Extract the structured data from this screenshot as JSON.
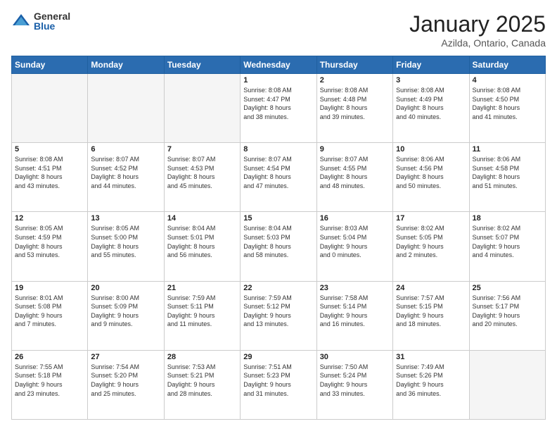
{
  "header": {
    "logo": {
      "general": "General",
      "blue": "Blue"
    },
    "title": "January 2025",
    "location": "Azilda, Ontario, Canada"
  },
  "days_of_week": [
    "Sunday",
    "Monday",
    "Tuesday",
    "Wednesday",
    "Thursday",
    "Friday",
    "Saturday"
  ],
  "weeks": [
    [
      {
        "day": "",
        "info": ""
      },
      {
        "day": "",
        "info": ""
      },
      {
        "day": "",
        "info": ""
      },
      {
        "day": "1",
        "info": "Sunrise: 8:08 AM\nSunset: 4:47 PM\nDaylight: 8 hours\nand 38 minutes."
      },
      {
        "day": "2",
        "info": "Sunrise: 8:08 AM\nSunset: 4:48 PM\nDaylight: 8 hours\nand 39 minutes."
      },
      {
        "day": "3",
        "info": "Sunrise: 8:08 AM\nSunset: 4:49 PM\nDaylight: 8 hours\nand 40 minutes."
      },
      {
        "day": "4",
        "info": "Sunrise: 8:08 AM\nSunset: 4:50 PM\nDaylight: 8 hours\nand 41 minutes."
      }
    ],
    [
      {
        "day": "5",
        "info": "Sunrise: 8:08 AM\nSunset: 4:51 PM\nDaylight: 8 hours\nand 43 minutes."
      },
      {
        "day": "6",
        "info": "Sunrise: 8:07 AM\nSunset: 4:52 PM\nDaylight: 8 hours\nand 44 minutes."
      },
      {
        "day": "7",
        "info": "Sunrise: 8:07 AM\nSunset: 4:53 PM\nDaylight: 8 hours\nand 45 minutes."
      },
      {
        "day": "8",
        "info": "Sunrise: 8:07 AM\nSunset: 4:54 PM\nDaylight: 8 hours\nand 47 minutes."
      },
      {
        "day": "9",
        "info": "Sunrise: 8:07 AM\nSunset: 4:55 PM\nDaylight: 8 hours\nand 48 minutes."
      },
      {
        "day": "10",
        "info": "Sunrise: 8:06 AM\nSunset: 4:56 PM\nDaylight: 8 hours\nand 50 minutes."
      },
      {
        "day": "11",
        "info": "Sunrise: 8:06 AM\nSunset: 4:58 PM\nDaylight: 8 hours\nand 51 minutes."
      }
    ],
    [
      {
        "day": "12",
        "info": "Sunrise: 8:05 AM\nSunset: 4:59 PM\nDaylight: 8 hours\nand 53 minutes."
      },
      {
        "day": "13",
        "info": "Sunrise: 8:05 AM\nSunset: 5:00 PM\nDaylight: 8 hours\nand 55 minutes."
      },
      {
        "day": "14",
        "info": "Sunrise: 8:04 AM\nSunset: 5:01 PM\nDaylight: 8 hours\nand 56 minutes."
      },
      {
        "day": "15",
        "info": "Sunrise: 8:04 AM\nSunset: 5:03 PM\nDaylight: 8 hours\nand 58 minutes."
      },
      {
        "day": "16",
        "info": "Sunrise: 8:03 AM\nSunset: 5:04 PM\nDaylight: 9 hours\nand 0 minutes."
      },
      {
        "day": "17",
        "info": "Sunrise: 8:02 AM\nSunset: 5:05 PM\nDaylight: 9 hours\nand 2 minutes."
      },
      {
        "day": "18",
        "info": "Sunrise: 8:02 AM\nSunset: 5:07 PM\nDaylight: 9 hours\nand 4 minutes."
      }
    ],
    [
      {
        "day": "19",
        "info": "Sunrise: 8:01 AM\nSunset: 5:08 PM\nDaylight: 9 hours\nand 7 minutes."
      },
      {
        "day": "20",
        "info": "Sunrise: 8:00 AM\nSunset: 5:09 PM\nDaylight: 9 hours\nand 9 minutes."
      },
      {
        "day": "21",
        "info": "Sunrise: 7:59 AM\nSunset: 5:11 PM\nDaylight: 9 hours\nand 11 minutes."
      },
      {
        "day": "22",
        "info": "Sunrise: 7:59 AM\nSunset: 5:12 PM\nDaylight: 9 hours\nand 13 minutes."
      },
      {
        "day": "23",
        "info": "Sunrise: 7:58 AM\nSunset: 5:14 PM\nDaylight: 9 hours\nand 16 minutes."
      },
      {
        "day": "24",
        "info": "Sunrise: 7:57 AM\nSunset: 5:15 PM\nDaylight: 9 hours\nand 18 minutes."
      },
      {
        "day": "25",
        "info": "Sunrise: 7:56 AM\nSunset: 5:17 PM\nDaylight: 9 hours\nand 20 minutes."
      }
    ],
    [
      {
        "day": "26",
        "info": "Sunrise: 7:55 AM\nSunset: 5:18 PM\nDaylight: 9 hours\nand 23 minutes."
      },
      {
        "day": "27",
        "info": "Sunrise: 7:54 AM\nSunset: 5:20 PM\nDaylight: 9 hours\nand 25 minutes."
      },
      {
        "day": "28",
        "info": "Sunrise: 7:53 AM\nSunset: 5:21 PM\nDaylight: 9 hours\nand 28 minutes."
      },
      {
        "day": "29",
        "info": "Sunrise: 7:51 AM\nSunset: 5:23 PM\nDaylight: 9 hours\nand 31 minutes."
      },
      {
        "day": "30",
        "info": "Sunrise: 7:50 AM\nSunset: 5:24 PM\nDaylight: 9 hours\nand 33 minutes."
      },
      {
        "day": "31",
        "info": "Sunrise: 7:49 AM\nSunset: 5:26 PM\nDaylight: 9 hours\nand 36 minutes."
      },
      {
        "day": "",
        "info": ""
      }
    ]
  ]
}
